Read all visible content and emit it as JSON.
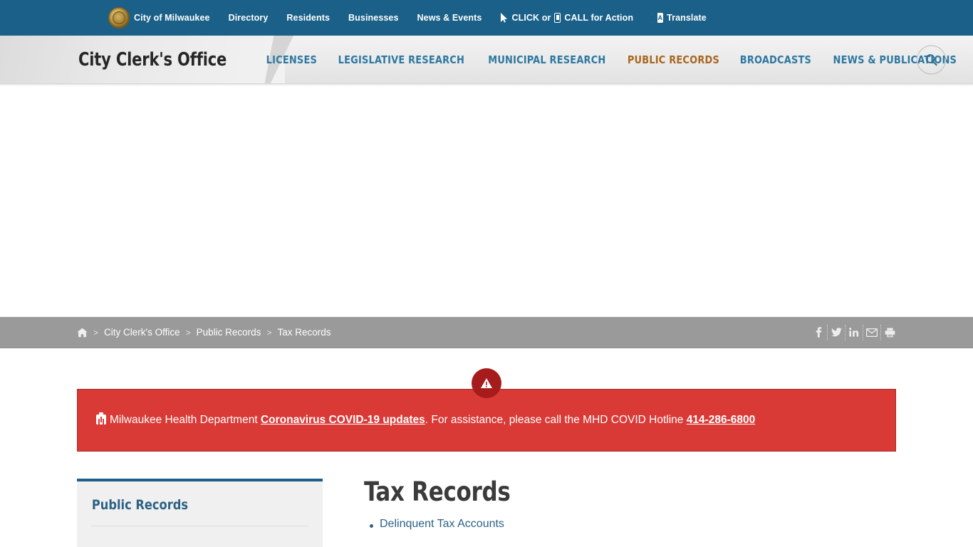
{
  "topbar": {
    "background": "#1a6088",
    "items": [
      {
        "label": "City of Milwaukee",
        "icon": "milwaukee-seal-icon"
      },
      {
        "label": "Directory",
        "icon": ""
      },
      {
        "label": "Residents",
        "icon": ""
      },
      {
        "label": "Businesses",
        "icon": ""
      },
      {
        "label": "News & Events",
        "icon": ""
      },
      {
        "label_pre": "CLICK or",
        "label_post": "CALL for Action",
        "icon": "cursor-icon",
        "icon2": "mobile-phone-icon"
      },
      {
        "label": "Translate",
        "icon": "translate-icon"
      }
    ]
  },
  "header": {
    "site_title": "City Clerk's Office",
    "nav": [
      {
        "label": "LICENSES",
        "active": false
      },
      {
        "label": "LEGISLATIVE RESEARCH",
        "active": false
      },
      {
        "label": "MUNICIPAL RESEARCH",
        "active": false
      },
      {
        "label": "PUBLIC RECORDS",
        "active": true
      },
      {
        "label": "BROADCASTS",
        "active": false
      },
      {
        "label": "NEWS & PUBLICATIONS",
        "active": false
      }
    ],
    "nav_link_color": "#2e78a0",
    "nav_active_color": "#a8671f",
    "search_icon": "search-icon"
  },
  "breadcrumb": {
    "background": "#9a9a9a",
    "home_icon": "home-icon",
    "separator": ">",
    "items": [
      {
        "label": "City Clerk's Office"
      },
      {
        "label": "Public Records"
      },
      {
        "label": "Tax Records"
      }
    ],
    "share": [
      {
        "name": "facebook-icon",
        "glyph": "f"
      },
      {
        "name": "twitter-icon",
        "glyph": "t"
      },
      {
        "name": "linkedin-icon",
        "glyph": "in"
      },
      {
        "name": "email-icon",
        "glyph": "mail"
      },
      {
        "name": "print-icon",
        "glyph": "print"
      }
    ]
  },
  "alert": {
    "badge_icon": "warning-triangle-icon",
    "badge_color": "#a61c1c",
    "background": "#d93a36",
    "kit_icon": "medical-kit-icon",
    "text_before": "Milwaukee Health Department ",
    "link_text": "Coronavirus COVID-19 updates",
    "text_middle": ". For assistance, please call the MHD COVID Hotline ",
    "phone": "414-286-6800"
  },
  "sidebar": {
    "title": "Public Records",
    "accent_color": "#1f5f86"
  },
  "main": {
    "title": "Tax Records",
    "links": [
      {
        "label": "Delinquent Tax Accounts"
      }
    ]
  }
}
